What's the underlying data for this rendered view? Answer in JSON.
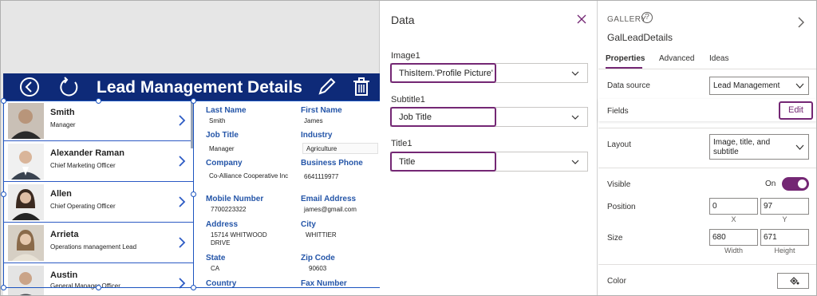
{
  "app": {
    "title": "Lead Management Details",
    "gallery": [
      {
        "name": "Smith",
        "subtitle": "Manager"
      },
      {
        "name": "Alexander Raman",
        "subtitle": "Chief Marketing Officer"
      },
      {
        "name": "Allen",
        "subtitle": "Chief Operating Officer"
      },
      {
        "name": "Arrieta",
        "subtitle": "Operations management Lead"
      },
      {
        "name": "Austin",
        "subtitle": "General Manager Officer"
      }
    ],
    "details": {
      "last_name_label": "Last Name",
      "last_name": "Smith",
      "first_name_label": "First Name",
      "first_name": "James",
      "job_title_label": "Job Title",
      "job_title": "Manager",
      "industry_label": "Industry",
      "industry": "Agriculture",
      "company_label": "Company",
      "company": "Co-Alliance Cooperative Inc",
      "business_phone_label": "Business Phone",
      "business_phone": "6641119977",
      "mobile_label": "Mobile Number",
      "mobile": "7700223322",
      "email_label": "Email Address",
      "email": "james@gmail.com",
      "address_label": "Address",
      "address": "15714 WHITWOOD DRIVE",
      "city_label": "City",
      "city": "WHITTIER",
      "state_label": "State",
      "state": "CA",
      "zip_label": "Zip Code",
      "zip": "90603",
      "country_label": "Country",
      "fax_label": "Fax Number"
    }
  },
  "data_panel": {
    "title": "Data",
    "fields": [
      {
        "label": "Image1",
        "value": "ThisItem.'Profile Picture'"
      },
      {
        "label": "Subtitle1",
        "value": "Job Title"
      },
      {
        "label": "Title1",
        "value": "Title"
      }
    ]
  },
  "properties": {
    "control_type": "GALLERY",
    "help_glyph": "?",
    "control_name": "GalLeadDetails",
    "tabs": [
      "Properties",
      "Advanced",
      "Ideas"
    ],
    "data_source_label": "Data source",
    "data_source_value": "Lead Management",
    "fields_label": "Fields",
    "edit_label": "Edit",
    "layout_label": "Layout",
    "layout_value": "Image, title, and subtitle",
    "visible_label": "Visible",
    "visible_state": "On",
    "position_label": "Position",
    "position_x": "0",
    "position_y": "97",
    "x_caption": "X",
    "y_caption": "Y",
    "size_label": "Size",
    "width": "680",
    "height": "671",
    "width_caption": "Width",
    "height_caption": "Height",
    "color_label": "Color"
  },
  "colors": {
    "header": "#0e2a78",
    "accent": "#742774",
    "label_blue": "#2455a8",
    "selection": "#1b54c0"
  }
}
